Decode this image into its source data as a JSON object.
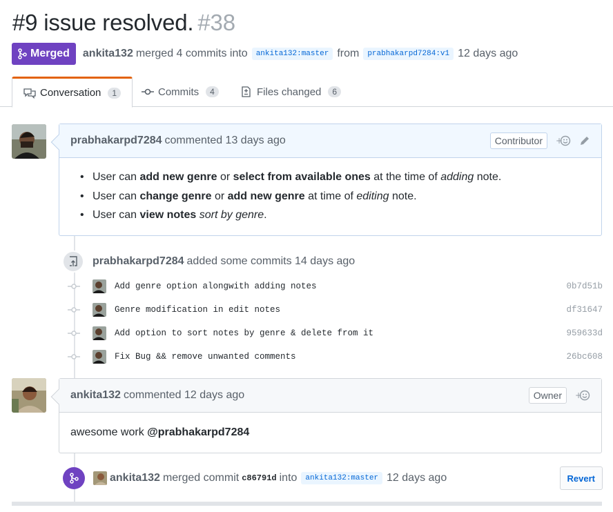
{
  "pr": {
    "title": "#9 issue resolved.",
    "number": "#38",
    "state_label": "Merged",
    "author": "ankita132",
    "merge_text": "merged 4 commits into",
    "base_branch": "ankita132:master",
    "from_text": "from",
    "head_branch": "prabhakarpd7284:v1",
    "time": "12 days ago"
  },
  "tabs": [
    {
      "label": "Conversation",
      "count": "1",
      "icon": "comment-discussion-icon"
    },
    {
      "label": "Commits",
      "count": "4",
      "icon": "git-commit-icon"
    },
    {
      "label": "Files changed",
      "count": "6",
      "icon": "file-diff-icon"
    }
  ],
  "comment1": {
    "author": "prabhakarpd7284",
    "action": "commented 13 days ago",
    "role": "Contributor",
    "reaction": "+☺",
    "items": [
      {
        "p1": "User can ",
        "b1": "add new genre",
        "p2": " or ",
        "b2": "select from available ones",
        "p3": " at the time of ",
        "i1": "adding",
        "p4": " note."
      },
      {
        "p1": "User can ",
        "b1": "change genre",
        "p2": " or ",
        "b2": "add new genre",
        "p3": " at time of ",
        "i1": "editing",
        "p4": " note."
      },
      {
        "p1": "User can ",
        "b1": "view notes",
        "p2": " ",
        "i1": "sort by genre",
        "p3": "."
      }
    ]
  },
  "commit_group": {
    "author": "prabhakarpd7284",
    "text": "added some commits 14 days ago",
    "commits": [
      {
        "message": "Add genre option alongwith adding notes",
        "sha": "0b7d51b"
      },
      {
        "message": "Genre modification in edit notes",
        "sha": "df31647"
      },
      {
        "message": "Add option to sort notes by genre & delete from it",
        "sha": "959633d"
      },
      {
        "message": "Fix Bug && remove unwanted comments",
        "sha": "26bc608"
      }
    ]
  },
  "comment2": {
    "author": "ankita132",
    "action": "commented 12 days ago",
    "role": "Owner",
    "reaction": "+☺",
    "body_text": "awesome work ",
    "mention": "@prabhakarpd7284"
  },
  "merge_event": {
    "author": "ankita132",
    "text": "merged commit",
    "sha": "c86791d",
    "into_text": "into",
    "branch": "ankita132:master",
    "time": "12 days ago",
    "revert_label": "Revert"
  },
  "colors": {
    "merged_purple": "#6f42c1",
    "link_blue": "#0366d6",
    "tab_accent": "#e36209"
  }
}
